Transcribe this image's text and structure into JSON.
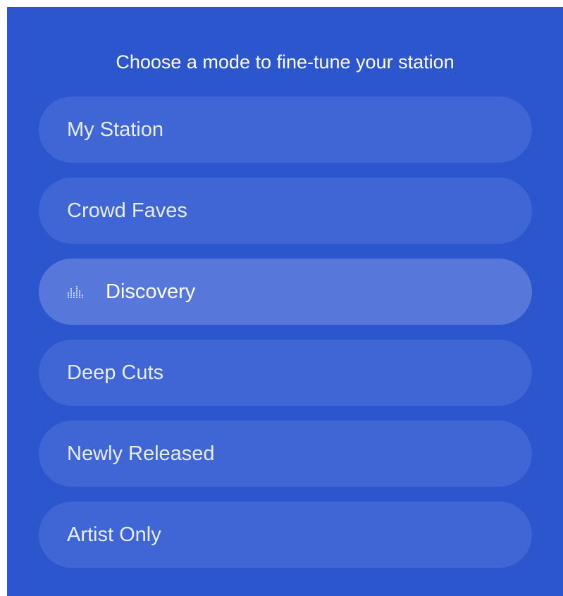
{
  "header": {
    "prompt": "Choose a mode to fine-tune your station"
  },
  "modes": [
    {
      "label": "My Station",
      "selected": false
    },
    {
      "label": "Crowd Faves",
      "selected": false
    },
    {
      "label": "Discovery",
      "selected": true,
      "indicator_icon": "equalizer-icon"
    },
    {
      "label": "Deep Cuts",
      "selected": false
    },
    {
      "label": "Newly Released",
      "selected": false
    },
    {
      "label": "Artist Only",
      "selected": false
    }
  ],
  "colors": {
    "background": "#2c56cd",
    "pill": "#3f66d4",
    "pill_selected": "#5778da",
    "text": "#ffffff"
  }
}
